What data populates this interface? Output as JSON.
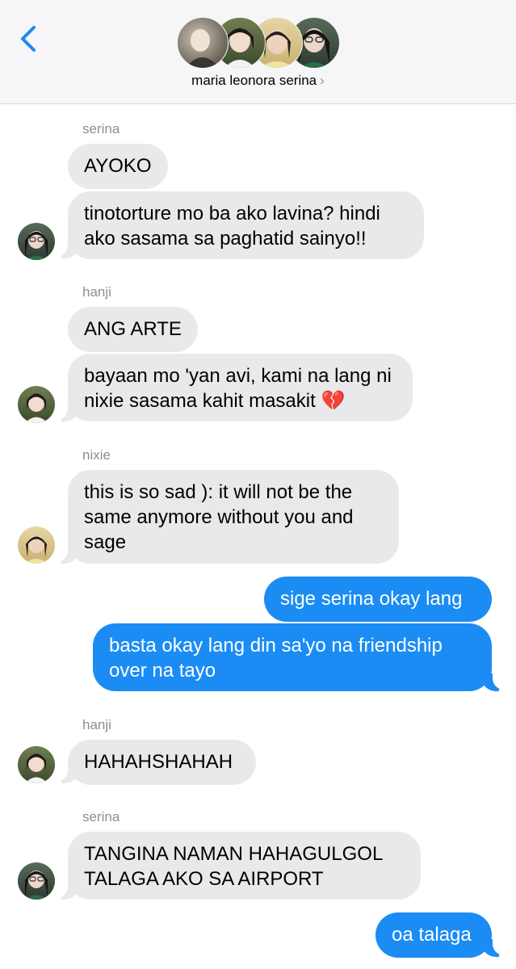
{
  "header": {
    "group_name": "maria leonora serina",
    "chevron": "›",
    "back_icon": "chevron-left-icon",
    "accent": "#1b8cf4"
  },
  "colors": {
    "incoming_bubble": "#e9e9eb",
    "outgoing_bubble": "#1b8cf4",
    "sender_label": "#8e8e93"
  },
  "messages": [
    {
      "sender": "serina"
    },
    {
      "text": "AYOKO"
    },
    {
      "text": "tinotorture mo ba ako lavina? hindi ako sasama sa paghatid sainyo!!"
    },
    {
      "sender": "hanji"
    },
    {
      "text": "ANG ARTE"
    },
    {
      "text": "bayaan mo 'yan avi, kami na lang ni nixie sasama kahit masakit 💔"
    },
    {
      "sender": "nixie"
    },
    {
      "text": "this is so sad ): it will not be the same anymore without you and sage"
    },
    {
      "text": "sige serina okay lang"
    },
    {
      "text": "basta okay lang din sa'yo na friendship over na tayo"
    },
    {
      "sender": "hanji"
    },
    {
      "text": "HAHAHSHAHAH"
    },
    {
      "sender": "serina"
    },
    {
      "text": "TANGINA NAMAN HAHAGULGOL TALAGA AKO SA AIRPORT"
    },
    {
      "text": "oa talaga"
    }
  ]
}
